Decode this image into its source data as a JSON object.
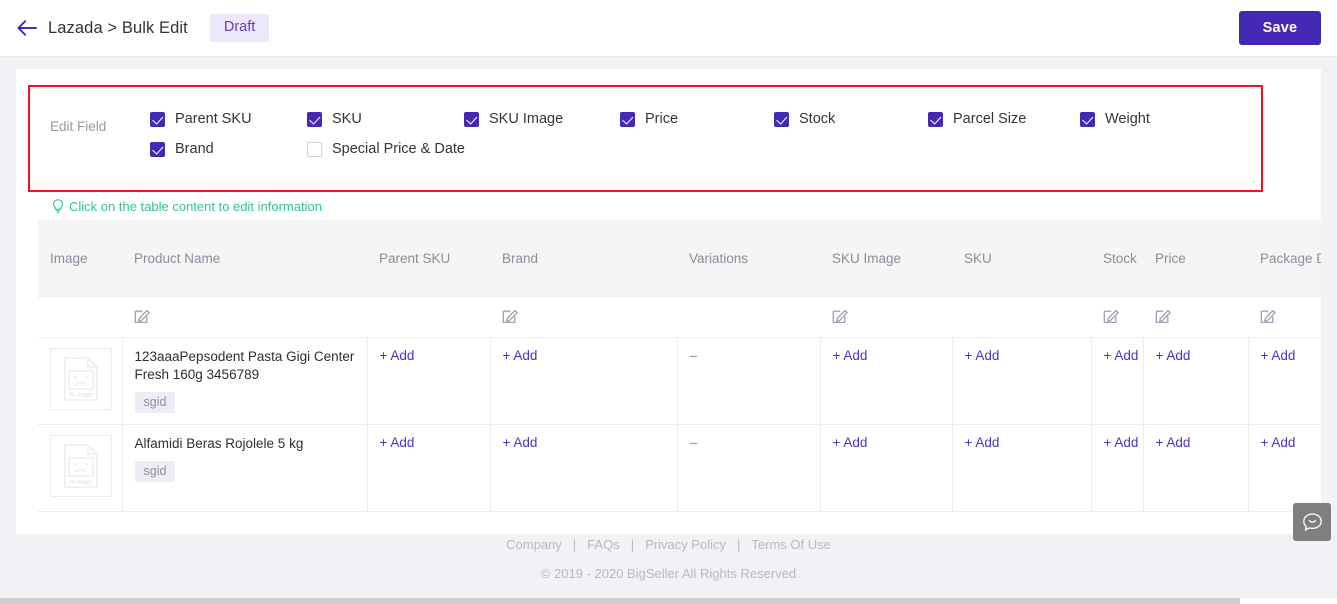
{
  "topbar": {
    "back_icon": "arrow-left-icon",
    "breadcrumb": "Lazada > Bulk Edit",
    "status_badge": "Draft",
    "save_label": "Save",
    "accent_color": "#4429b5",
    "badge_bg": "#ece7fb"
  },
  "edit_field": {
    "label": "Edit Field",
    "border_color": "#fc0d1b",
    "options": [
      {
        "label": "Parent SKU",
        "checked": true,
        "col": 0,
        "row": 0
      },
      {
        "label": "SKU",
        "checked": true,
        "col": 1,
        "row": 0
      },
      {
        "label": "SKU Image",
        "checked": true,
        "col": 2,
        "row": 0
      },
      {
        "label": "Price",
        "checked": true,
        "col": 3,
        "row": 0
      },
      {
        "label": "Stock",
        "checked": true,
        "col": 4,
        "row": 0
      },
      {
        "label": "Parcel Size",
        "checked": true,
        "col": 5,
        "row": 0
      },
      {
        "label": "Weight",
        "checked": true,
        "col": 6,
        "row": 0
      },
      {
        "label": "Brand",
        "checked": true,
        "col": 0,
        "row": 1
      },
      {
        "label": "Special Price & Date",
        "checked": false,
        "col": 1,
        "row": 1
      }
    ]
  },
  "hint": {
    "icon": "lightbulb-icon",
    "text": "Click on the table content to edit information",
    "color": "#2ec49a"
  },
  "table": {
    "columns": [
      "Image",
      "Product Name",
      "Parent SKU",
      "Brand",
      "Variations",
      "SKU Image",
      "SKU",
      "Stock",
      "Price",
      "Package Dimension (cm)"
    ],
    "bulk_edit_icons": [
      {
        "column": "Product Name",
        "icon": "edit-pencil-icon"
      },
      {
        "column": "Brand",
        "icon": "edit-pencil-icon"
      },
      {
        "column": "SKU Image",
        "icon": "edit-pencil-icon"
      },
      {
        "column": "Stock",
        "icon": "edit-pencil-icon"
      },
      {
        "column": "Price",
        "icon": "edit-pencil-icon"
      },
      {
        "column": "Package Dimension (cm)",
        "icon": "edit-pencil-icon"
      }
    ],
    "add_label": "+ Add",
    "empty_label": "--",
    "no_image_label": "No Image",
    "rows": [
      {
        "image": "no-image-placeholder",
        "product_name": "123aaaPepsodent Pasta Gigi Center Fresh 160g 3456789",
        "tag": "sgid",
        "parent_sku": "+ Add",
        "brand": "+ Add",
        "variations": "--",
        "sku_image": "+ Add",
        "sku": "+ Add",
        "stock": "+ Add",
        "price": "+ Add",
        "package_dimension": "+ Add"
      },
      {
        "image": "no-image-placeholder",
        "product_name": "Alfamidi Beras Rojolele 5 kg",
        "tag": "sgid",
        "parent_sku": "+ Add",
        "brand": "+ Add",
        "variations": "--",
        "sku_image": "+ Add",
        "sku": "+ Add",
        "stock": "+ Add",
        "price": "+ Add",
        "package_dimension": "+ Add"
      }
    ]
  },
  "footer": {
    "links": [
      "Company",
      "FAQs",
      "Privacy Policy",
      "Terms Of Use"
    ],
    "separator": "|",
    "copyright": "© 2019 - 2020 BigSeller All Rights Reserved"
  },
  "chat_widget": {
    "icon": "chat-bubble-smile-icon"
  }
}
